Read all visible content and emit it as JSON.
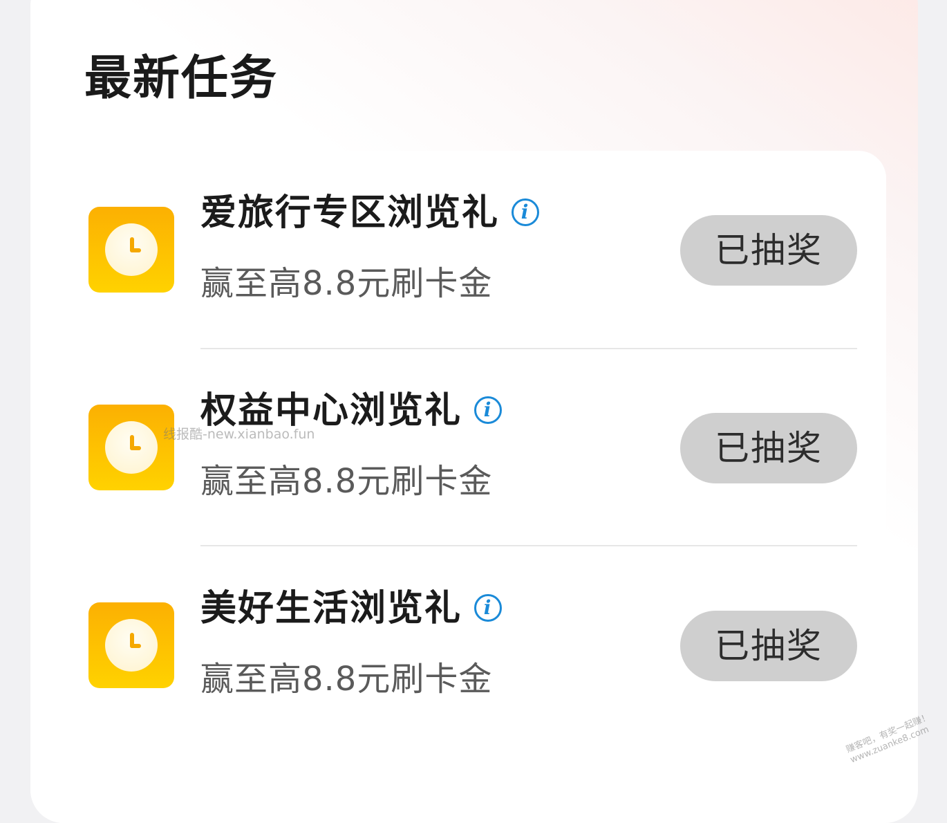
{
  "section": {
    "title": "最新任务"
  },
  "tasks": [
    {
      "title": "爱旅行专区浏览礼",
      "subtitle": "赢至高8.8元刷卡金",
      "button_label": "已抽奖",
      "icon": "clock-icon",
      "info_icon_glyph": "i"
    },
    {
      "title": "权益中心浏览礼",
      "subtitle": "赢至高8.8元刷卡金",
      "button_label": "已抽奖",
      "icon": "clock-icon",
      "info_icon_glyph": "i"
    },
    {
      "title": "美好生活浏览礼",
      "subtitle": "赢至高8.8元刷卡金",
      "button_label": "已抽奖",
      "icon": "clock-icon",
      "info_icon_glyph": "i"
    }
  ],
  "watermarks": {
    "center": "线报酷-new.xianbao.fun",
    "corner_line1": "赚客吧，有奖一起赚！",
    "corner_line2": "www.zuanke8.com"
  },
  "colors": {
    "icon_gradient_top": "#fcb002",
    "icon_gradient_bottom": "#ffd200",
    "info_icon": "#1a8ad8",
    "button_bg": "#cfcfcf",
    "button_text": "#2d2d2d"
  }
}
